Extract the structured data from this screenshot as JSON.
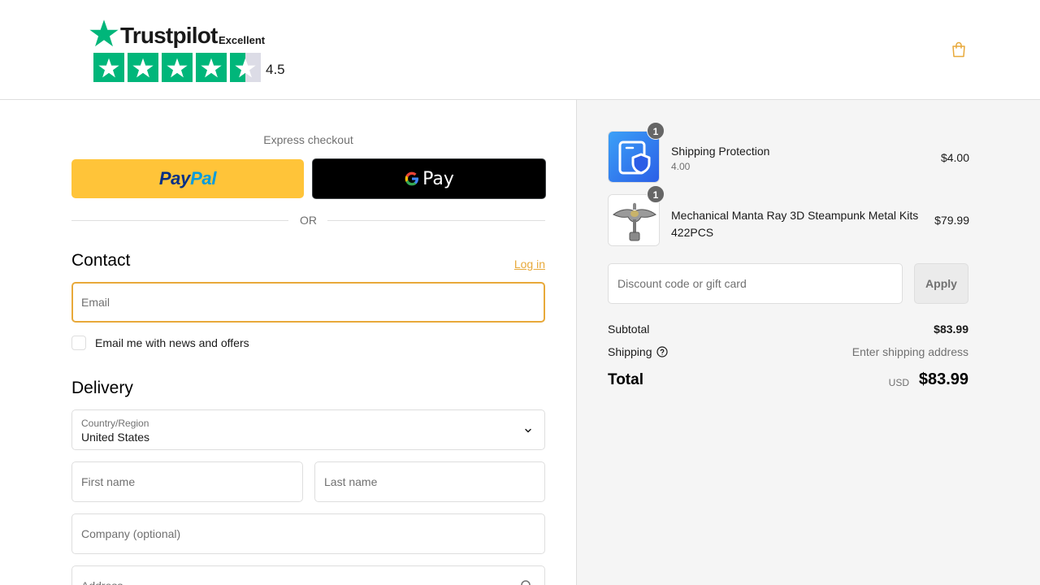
{
  "header": {
    "trustpilot": {
      "brand": "Trustpilot",
      "rating_word": "Excellent",
      "score": "4.5",
      "stars": 4.5,
      "brand_color": "#00b67a"
    },
    "cart_icon": "shopping-bag-icon",
    "accent_color": "#e8a93a"
  },
  "express": {
    "label": "Express checkout",
    "paypal_label_pay": "Pay",
    "paypal_label_pal": "Pal",
    "gpay_label": "Pay",
    "or_label": "OR"
  },
  "contact": {
    "title": "Contact",
    "login_label": "Log in",
    "email_placeholder": "Email",
    "newsletter_label": "Email me with news and offers"
  },
  "delivery": {
    "title": "Delivery",
    "country_label": "Country/Region",
    "country_value": "United States",
    "first_name_placeholder": "First name",
    "last_name_placeholder": "Last name",
    "company_placeholder": "Company (optional)",
    "address_placeholder": "Address"
  },
  "summary": {
    "items": [
      {
        "name": "Shipping Protection",
        "variant": "4.00",
        "price": "$4.00",
        "qty": "1"
      },
      {
        "name": "Mechanical Manta Ray 3D Steampunk Metal Kits 422PCS",
        "variant": "",
        "price": "$79.99",
        "qty": "1"
      }
    ],
    "discount_placeholder": "Discount code or gift card",
    "apply_label": "Apply",
    "subtotal_label": "Subtotal",
    "subtotal_value": "$83.99",
    "shipping_label": "Shipping",
    "shipping_value": "Enter shipping address",
    "total_label": "Total",
    "total_currency": "USD",
    "total_value": "$83.99"
  }
}
